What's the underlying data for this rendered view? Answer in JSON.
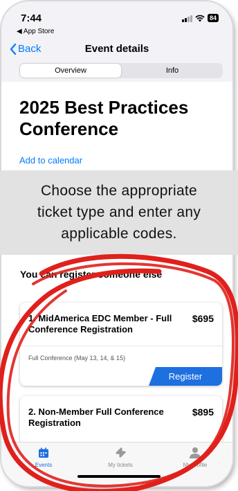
{
  "status_bar": {
    "time": "7:44",
    "back_app": "◀ App Store",
    "battery": "84"
  },
  "nav": {
    "back_label": "Back",
    "title": "Event details"
  },
  "segments": [
    {
      "label": "Overview",
      "active": true
    },
    {
      "label": "Info",
      "active": false
    }
  ],
  "event": {
    "title": "2025 Best Practices Conference",
    "add_to_calendar": "Add to calendar"
  },
  "banner": {
    "line1": "Choose the appropriate",
    "line2": "ticket type and enter any",
    "line3": "applicable codes."
  },
  "register_heading": "You can register someone else",
  "tickets": [
    {
      "name": "1. MidAmerica EDC Member - Full Conference Registration",
      "price": "$695",
      "description": "Full Conference (May 13, 14, & 15)",
      "button": "Register"
    },
    {
      "name": "2. Non-Member Full Conference Registration",
      "price": "$895"
    }
  ],
  "tabs": [
    {
      "label": "Events",
      "icon": "calendar-icon",
      "active": true
    },
    {
      "label": "My tickets",
      "icon": "ticket-icon",
      "active": false
    },
    {
      "label": "My profile",
      "icon": "person-icon",
      "active": false
    }
  ],
  "colors": {
    "accent": "#007aff",
    "button": "#1e6fe0",
    "scribble": "#e0201c",
    "banner_bg": "#e1e1e1"
  }
}
